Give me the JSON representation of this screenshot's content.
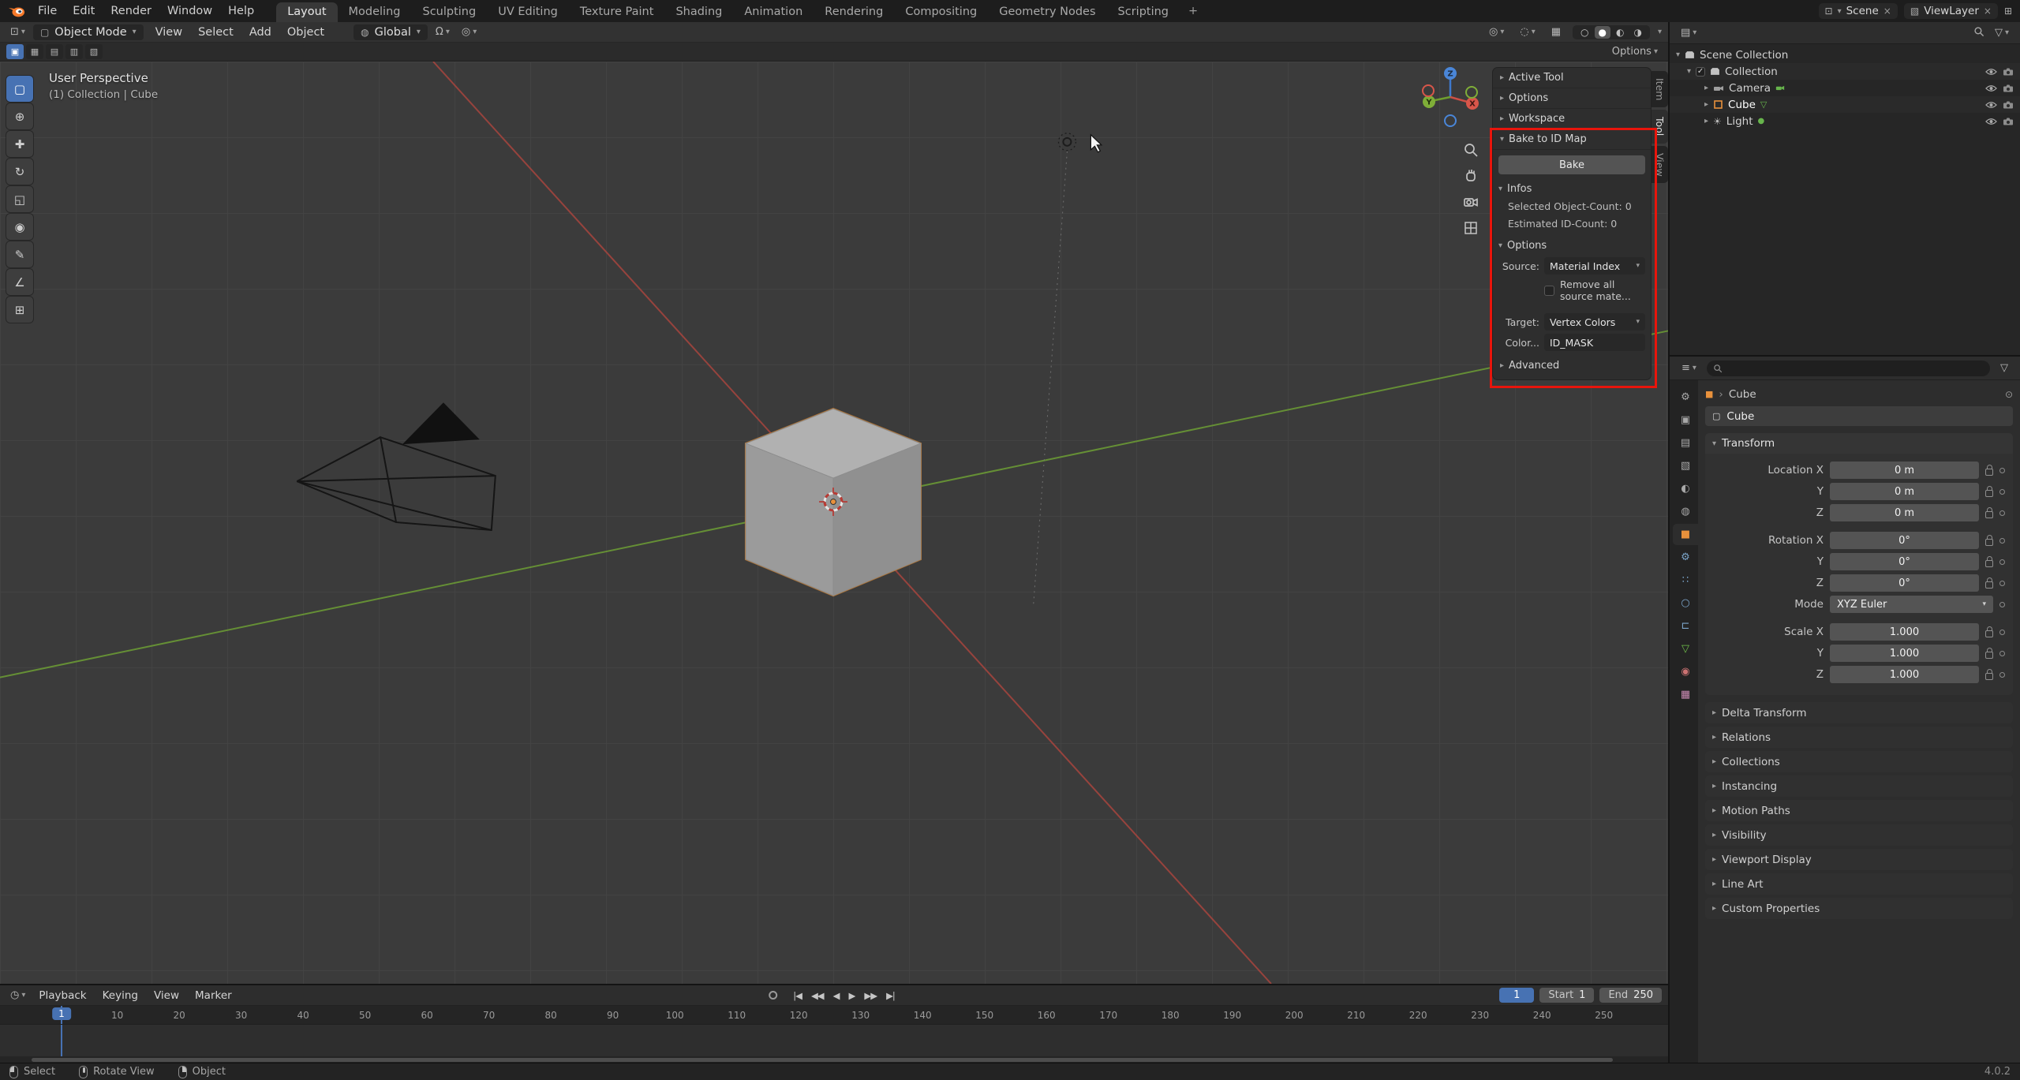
{
  "colors": {
    "accent_blue": "#4772b3",
    "object_orange": "#e8913c",
    "annotation_red": "#e8150c",
    "axis_x_red": "#a8453e",
    "axis_y_green": "#6d9e35"
  },
  "topbar": {
    "menus": [
      "File",
      "Edit",
      "Render",
      "Window",
      "Help"
    ],
    "workspace_tabs": [
      {
        "label": "Layout",
        "name": "tab-layout",
        "active": true
      },
      {
        "label": "Modeling",
        "name": "tab-modeling"
      },
      {
        "label": "Sculpting",
        "name": "tab-sculpting"
      },
      {
        "label": "UV Editing",
        "name": "tab-uv-editing"
      },
      {
        "label": "Texture Paint",
        "name": "tab-texture-paint"
      },
      {
        "label": "Shading",
        "name": "tab-shading"
      },
      {
        "label": "Animation",
        "name": "tab-animation"
      },
      {
        "label": "Rendering",
        "name": "tab-rendering"
      },
      {
        "label": "Compositing",
        "name": "tab-compositing"
      },
      {
        "label": "Geometry Nodes",
        "name": "tab-geometry-nodes"
      },
      {
        "label": "Scripting",
        "name": "tab-scripting"
      }
    ],
    "add_workspace_label": "+",
    "scene_selector": {
      "label": "Scene",
      "clear": "×"
    },
    "viewlayer_selector": {
      "label": "ViewLayer",
      "clear": "×"
    }
  },
  "viewport_header": {
    "mode_selector": "Object Mode",
    "menus": [
      "View",
      "Select",
      "Add",
      "Object"
    ],
    "orientation_selector": "Global",
    "snap_glyph": "Ω",
    "proportional_glyph": "◎",
    "shading_modes": [
      {
        "name": "shading-wireframe-button",
        "glyph": "○"
      },
      {
        "name": "shading-solid-button",
        "glyph": "●",
        "active": true
      },
      {
        "name": "shading-material-button",
        "glyph": "◐"
      },
      {
        "name": "shading-rendered-button",
        "glyph": "◑"
      }
    ],
    "select_mode_buttons": [
      {
        "name": "select-mode-new",
        "glyph": "▣",
        "active": true
      },
      {
        "name": "select-mode-extend",
        "glyph": "▦"
      },
      {
        "name": "select-mode-subtract",
        "glyph": "▤"
      },
      {
        "name": "select-mode-invert",
        "glyph": "▥"
      },
      {
        "name": "select-mode-intersect",
        "glyph": "▧"
      }
    ],
    "tool_settings_options": "Options"
  },
  "toolbar": {
    "tools": [
      {
        "name": "tool-select-box",
        "glyph": "▢",
        "active": true
      },
      {
        "name": "tool-cursor",
        "glyph": "⊕"
      },
      {
        "name": "tool-move",
        "glyph": "✚"
      },
      {
        "name": "tool-rotate",
        "glyph": "↻"
      },
      {
        "name": "tool-scale",
        "glyph": "◱"
      },
      {
        "name": "tool-transform",
        "glyph": "◉"
      },
      {
        "name": "tool-annotate",
        "glyph": "✎"
      },
      {
        "name": "tool-measure",
        "glyph": "∠"
      },
      {
        "name": "tool-add-cube",
        "glyph": "⊞"
      }
    ]
  },
  "viewport": {
    "view_label": "User Perspective",
    "context_label": "(1) Collection | Cube",
    "gizmo_axis_labels": {
      "x": "X",
      "y": "Y",
      "z": "Z"
    }
  },
  "n_panel": {
    "tabs": [
      {
        "label": "Item",
        "name": "n-panel-tab-item"
      },
      {
        "label": "Tool",
        "name": "n-panel-tab-tool",
        "active": true
      },
      {
        "label": "View",
        "name": "n-panel-tab-view"
      }
    ],
    "collapsed_sections": [
      "Active Tool",
      "Options",
      "Workspace"
    ],
    "bake": {
      "title": "Bake to ID Map",
      "bake_button": "Bake",
      "infos_title": "Infos",
      "info_lines": [
        "Selected Object-Count: 0",
        "Estimated ID-Count: 0"
      ],
      "options_title": "Options",
      "source_label": "Source:",
      "source_value": "Material Index",
      "remove_checkbox_label": "Remove all source mate...",
      "target_label": "Target:",
      "target_value": "Vertex Colors",
      "color_label": "Color...",
      "color_value": "ID_MASK",
      "advanced_label": "Advanced"
    }
  },
  "outliner": {
    "rows": [
      {
        "label": "Scene Collection"
      },
      {
        "label": "Collection"
      },
      {
        "label": "Camera"
      },
      {
        "label": "Cube"
      },
      {
        "label": "Light"
      }
    ]
  },
  "properties": {
    "breadcrumb_object": "Cube",
    "name_field": "Cube",
    "tabs": [
      {
        "name": "properties-tab-tool",
        "glyph": "⚙",
        "color": "#a8a8a8"
      },
      {
        "name": "properties-tab-render",
        "glyph": "▣",
        "color": "#a8a8a8"
      },
      {
        "name": "properties-tab-output",
        "glyph": "▤",
        "color": "#a8a8a8"
      },
      {
        "name": "properties-tab-view-layer",
        "glyph": "▧",
        "color": "#a8a8a8"
      },
      {
        "name": "properties-tab-scene",
        "glyph": "◐",
        "color": "#a8a8a8"
      },
      {
        "name": "properties-tab-world",
        "glyph": "◍",
        "color": "#a8a8a8"
      },
      {
        "name": "properties-tab-object",
        "glyph": "■",
        "color": "#e8913c",
        "active": true
      },
      {
        "name": "properties-tab-modifiers",
        "glyph": "⚙",
        "color": "#7ba4c9"
      },
      {
        "name": "properties-tab-particles",
        "glyph": "∷",
        "color": "#7ba4c9"
      },
      {
        "name": "properties-tab-physics",
        "glyph": "○",
        "color": "#7ba4c9"
      },
      {
        "name": "properties-tab-constraints",
        "glyph": "⊏",
        "color": "#7ba4c9"
      },
      {
        "name": "properties-tab-data",
        "glyph": "▽",
        "color": "#6fbf4a"
      },
      {
        "name": "properties-tab-material",
        "glyph": "◉",
        "color": "#cb7272"
      },
      {
        "name": "properties-tab-texture",
        "glyph": "▦",
        "color": "#c98ab2"
      }
    ],
    "transform": {
      "title": "Transform",
      "rows": [
        {
          "label": "Location X",
          "value": "0 m"
        },
        {
          "label": "Y",
          "value": "0 m"
        },
        {
          "label": "Z",
          "value": "0 m"
        },
        {
          "label": "Rotation X",
          "value": "0°"
        },
        {
          "label": "Y",
          "value": "0°"
        },
        {
          "label": "Z",
          "value": "0°"
        },
        {
          "label": "Mode",
          "value": "XYZ Euler"
        },
        {
          "label": "Scale X",
          "value": "1.000"
        },
        {
          "label": "Y",
          "value": "1.000"
        },
        {
          "label": "Z",
          "value": "1.000"
        }
      ]
    },
    "collapsed_panels": [
      "Delta Transform",
      "Relations",
      "Collections",
      "Instancing",
      "Motion Paths",
      "Visibility",
      "Viewport Display",
      "Line Art",
      "Custom Properties"
    ]
  },
  "timeline": {
    "menus": [
      "Playback",
      "Keying",
      "View",
      "Marker"
    ],
    "transport": [
      "|◀",
      "◀◀",
      "◀",
      "▶",
      "▶▶",
      "▶|"
    ],
    "current_frame": "1",
    "start_label": "Start",
    "start_value": "1",
    "end_label": "End",
    "end_value": "250",
    "ruler_frames": [
      10,
      20,
      30,
      40,
      50,
      60,
      70,
      80,
      90,
      100,
      110,
      120,
      130,
      140,
      150,
      160,
      170,
      180,
      190,
      200,
      210,
      220,
      230,
      240,
      250
    ]
  },
  "statusbar": {
    "hints": [
      {
        "label": "Select"
      },
      {
        "label": "Rotate View"
      },
      {
        "label": "Object"
      }
    ],
    "version": "4.0.2"
  }
}
